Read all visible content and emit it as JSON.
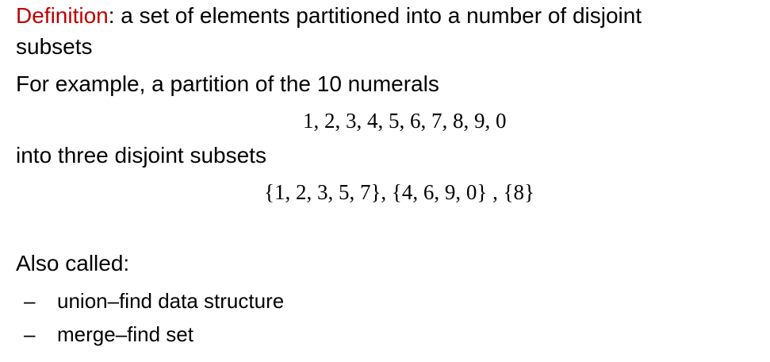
{
  "definition": {
    "term": "Definition",
    "text_line1": ": a set of elements partitioned into a number of disjoint",
    "text_line2": "subsets"
  },
  "example": {
    "intro": "For example, a partition of the 10 numerals",
    "numerals": "1, 2, 3, 4, 5, 6, 7, 8, 9, 0",
    "into": "into three disjoint subsets",
    "subsets": "{1, 2, 3, 5, 7}, {4, 6, 9, 0} , {8}"
  },
  "also_called": {
    "heading": "Also called:",
    "items": [
      {
        "dash": "–",
        "label": "union–find data structure"
      },
      {
        "dash": "–",
        "label": "merge–find set"
      }
    ]
  }
}
